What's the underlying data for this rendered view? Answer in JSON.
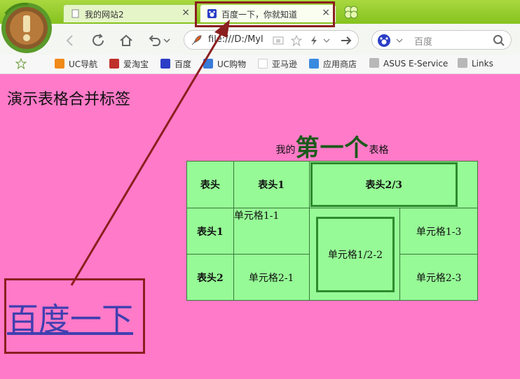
{
  "browser": {
    "tabs": [
      {
        "title": "我的网站2",
        "close": "×"
      },
      {
        "title": "百度一下，你就知道",
        "close": "×"
      }
    ],
    "address": "file:///D:/Myl",
    "search_placeholder": "百度",
    "bookmarks": [
      "UC导航",
      "爱淘宝",
      "百度",
      "UC购物",
      "亚马逊",
      "应用商店",
      "ASUS E-Service",
      "Links"
    ]
  },
  "page": {
    "heading": "演示表格合并标签",
    "caption": {
      "prefix": "我的",
      "big": "第一个",
      "suffix": "表格"
    },
    "table": {
      "headers": [
        "表头",
        "表头1",
        "表头2/3"
      ],
      "rows": [
        {
          "head": "表头1",
          "c1": "单元格1-1",
          "merged": "单元格1/2-2",
          "c3": "单元格1-3"
        },
        {
          "head": "表头2",
          "c1": "单元格2-1",
          "c3": "单元格2-3"
        }
      ]
    },
    "link": "百度一下"
  },
  "colors": {
    "page_bg": "#ff7ac8",
    "table_bg": "#96fa96",
    "annotation": "#8b1f1f",
    "link": "#3f3fb0"
  }
}
